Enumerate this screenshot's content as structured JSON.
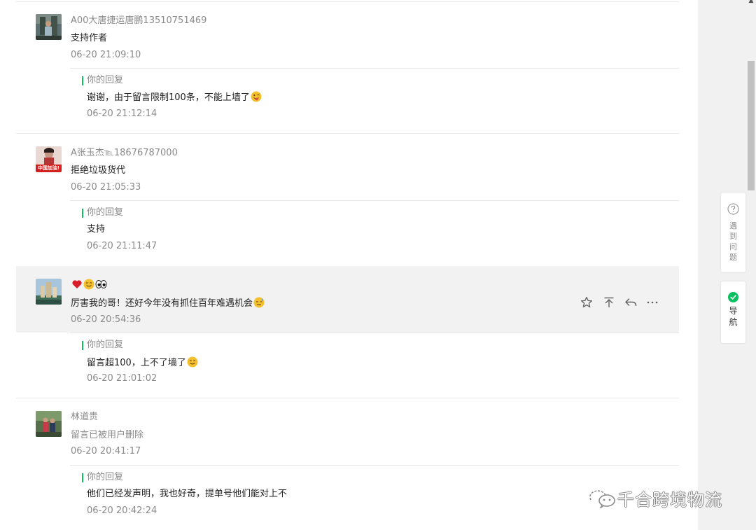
{
  "comments": [
    {
      "nickname": "A00大唐捷运唐鹏13510751469",
      "text": "支持作者",
      "time": "06-20 21:09:10",
      "reply": {
        "label": "你的回复",
        "text": "谢谢，由于留言限制100条，不能上墙了",
        "emoji": "tongue-wink-emoji",
        "time": "06-20 21:12:14"
      }
    },
    {
      "nickname": "A张玉杰℡18676787000",
      "avatar_caption": "中国加油!",
      "text": "拒绝垃圾货代",
      "time": "06-20 21:05:33",
      "reply": {
        "label": "你的回复",
        "text": "支持",
        "time": "06-20 21:11:47"
      }
    },
    {
      "nickname_emojis": [
        "red-heart-emoji",
        "smile-emoji",
        "eyes-emoji"
      ],
      "text": "厉害我的哥！还好今年没有抓住百年难遇机会",
      "emoji": "sweat-emoji",
      "time": "06-20 20:54:36",
      "highlighted": true,
      "actions": [
        "star-icon",
        "pin-top-icon",
        "reply-icon",
        "more-icon"
      ],
      "reply": {
        "label": "你的回复",
        "text": "留言超100，上不了墙了",
        "emoji": "smile-emoji",
        "time": "06-20 21:01:02"
      }
    },
    {
      "nickname": "林道贵",
      "text": "留言已被用户删除",
      "time": "06-20 20:41:17",
      "reply": {
        "label": "你的回复",
        "text": "他们已经发声明，我也好奇，提单号他们能对上不",
        "time": "06-20 20:42:24"
      }
    }
  ],
  "side_panel": {
    "help_label": "遇到问题",
    "nav_label": "导航"
  },
  "watermark": "千合跨境物流",
  "colors": {
    "accent_green": "#07c160",
    "muted_text": "#8a8a8a",
    "body_text": "#222222",
    "divider": "#e7e7e7",
    "highlight_bg": "#f2f2f2"
  }
}
